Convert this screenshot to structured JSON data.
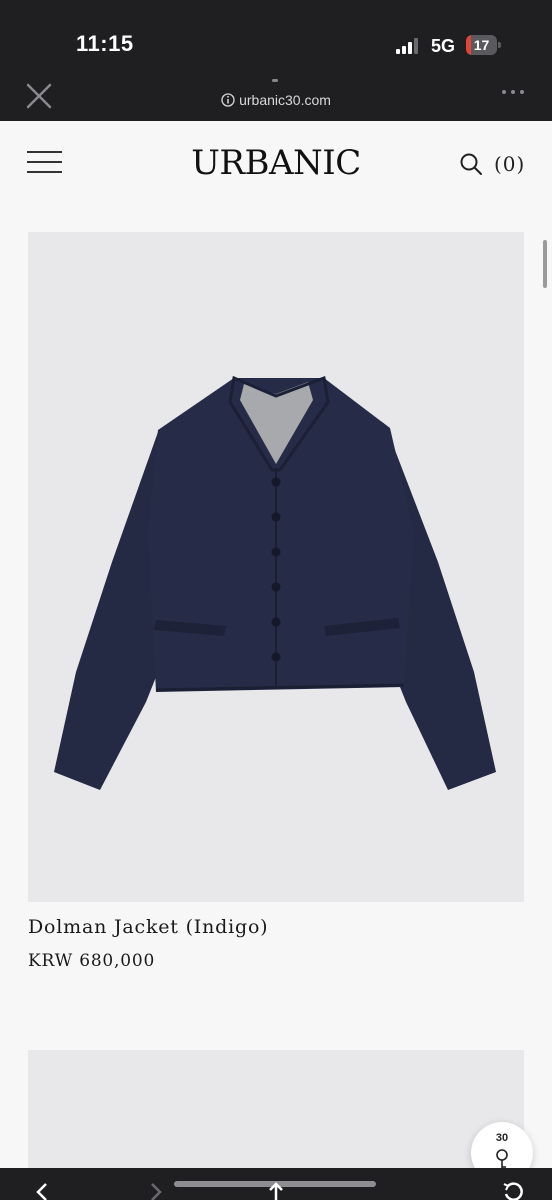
{
  "status_bar": {
    "time": "11:15",
    "network": "5G",
    "battery": "17",
    "battery_level": 0.17
  },
  "browser": {
    "url": "urbanic30.com",
    "close_icon": "close-icon",
    "more_icon": "more-dots-icon"
  },
  "header": {
    "logo": "URBANIC",
    "cart_label": "(0)",
    "menu_icon": "hamburger-icon",
    "search_icon": "search-icon"
  },
  "products": [
    {
      "name": "Dolman Jacket (Indigo)",
      "price": "KRW 680,000"
    }
  ],
  "badge": {
    "text": "30"
  },
  "colors": {
    "chrome_bg": "#1f1f22",
    "page_bg": "#f7f7f7",
    "image_bg": "#e8e8ea",
    "jacket": "#252b45",
    "battery_red": "#e0453a"
  }
}
